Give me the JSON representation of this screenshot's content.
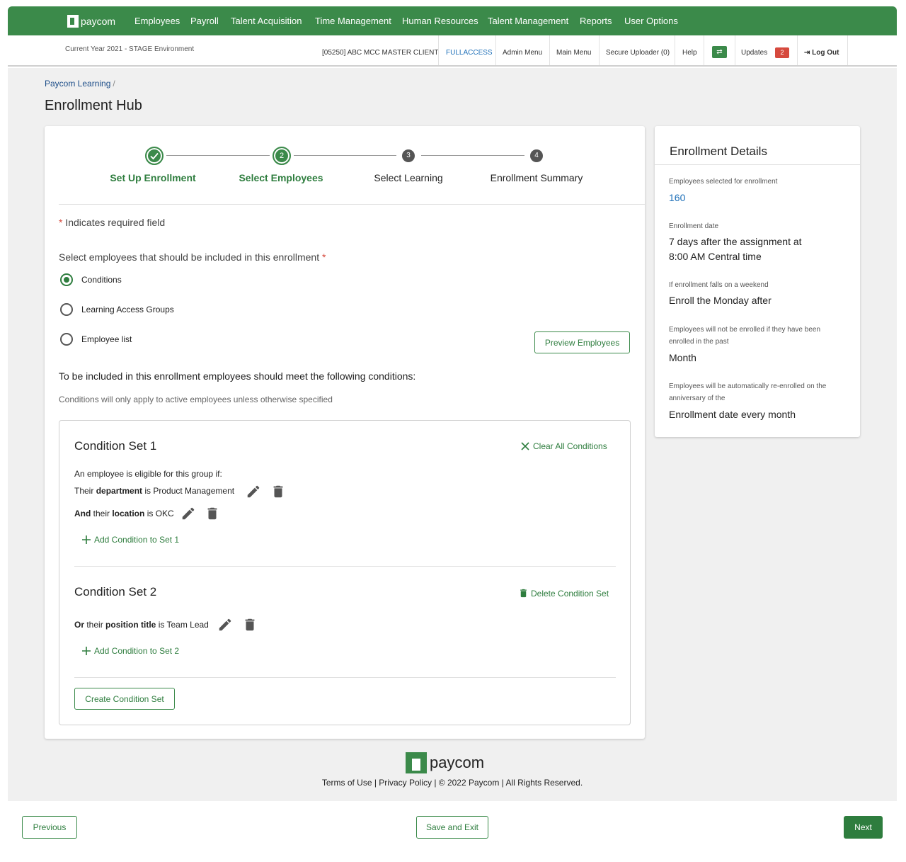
{
  "brand": {
    "logo_text": "paycom"
  },
  "topnav": {
    "items": [
      "Employees",
      "Payroll",
      "Talent Acquisition",
      "Time Management",
      "Human Resources",
      "Talent Management",
      "Reports",
      "User Options"
    ]
  },
  "subbar": {
    "environment": "Current Year 2021 - STAGE Environment",
    "client": "[05250] ABC MCC MASTER CLIENT",
    "access": "FULLACCESS",
    "admin_menu": "Admin Menu",
    "main_menu": "Main Menu",
    "secure_uploader": "Secure Uploader (0)",
    "help": "Help",
    "updates": "Updates",
    "updates_count": "2",
    "logout": "Log Out"
  },
  "breadcrumb": {
    "root": "Paycom Learning",
    "sep": "/"
  },
  "page_title": "Enrollment Hub",
  "stepper": {
    "steps": [
      {
        "number": "1",
        "label": "Set Up Enrollment",
        "state": "done"
      },
      {
        "number": "2",
        "label": "Select Employees",
        "state": "active"
      },
      {
        "number": "3",
        "label": "Select Learning",
        "state": "todo"
      },
      {
        "number": "4",
        "label": "Enrollment Summary",
        "state": "todo"
      }
    ]
  },
  "form": {
    "required_star": "*",
    "required_note": "Indicates required field",
    "select_prompt": "Select employees that should be included in this enrollment",
    "options": [
      {
        "label": "Conditions",
        "selected": true
      },
      {
        "label": "Learning Access Groups",
        "selected": false
      },
      {
        "label": "Employee list",
        "selected": false
      }
    ],
    "preview_button": "Preview Employees",
    "conditions_heading": "To be included in this enrollment employees should meet the following conditions:",
    "conditions_note": "Conditions will only apply to active employees unless otherwise specified"
  },
  "condition_sets": {
    "set1": {
      "title": "Condition Set 1",
      "clear_label": "Clear All Conditions",
      "intro": "An employee is eligible for this group if:",
      "cond1": {
        "prefix": "Their ",
        "field": "department",
        "mid": " is Product Management"
      },
      "cond2": {
        "lead": "And",
        "prefix": " their ",
        "field": "location",
        "mid": " is OKC"
      },
      "add_label": "Add Condition to Set 1"
    },
    "set2": {
      "title": "Condition Set 2",
      "delete_label": "Delete Condition Set",
      "cond1": {
        "lead": "Or",
        "prefix": " their ",
        "field": "position title",
        "mid": " is Team Lead"
      },
      "add_label": "Add Condition to Set 2"
    },
    "create_button": "Create Condition Set"
  },
  "details": {
    "title": "Enrollment Details",
    "employees_label": "Employees selected for enrollment",
    "employees_value": "160",
    "date_label": "Enrollment date",
    "date_value_1": "7 days after the assignment  at",
    "date_value_2": "8:00 AM Central time",
    "weekend_label": "If enrollment falls on a weekend",
    "weekend_value": "Enroll the Monday after",
    "past_label_1": "Employees will not be enrolled if they have been",
    "past_label_2": "enrolled in the past",
    "past_value": "Month",
    "reenroll_label_1": "Employees will be automatically re-enrolled on the",
    "reenroll_label_2": "anniversary of the",
    "reenroll_value": "Enrollment date every month"
  },
  "footer": {
    "logo_text": "paycom",
    "links": "Terms of Use | Privacy Policy | © 2022 Paycom | All Rights Reserved."
  },
  "bottom_bar": {
    "previous": "Previous",
    "save_exit": "Save and Exit",
    "next": "Next"
  },
  "colors": {
    "brand_green": "#3b8a4a",
    "link_blue": "#1d4e89",
    "badge_red": "#d64a3e"
  }
}
